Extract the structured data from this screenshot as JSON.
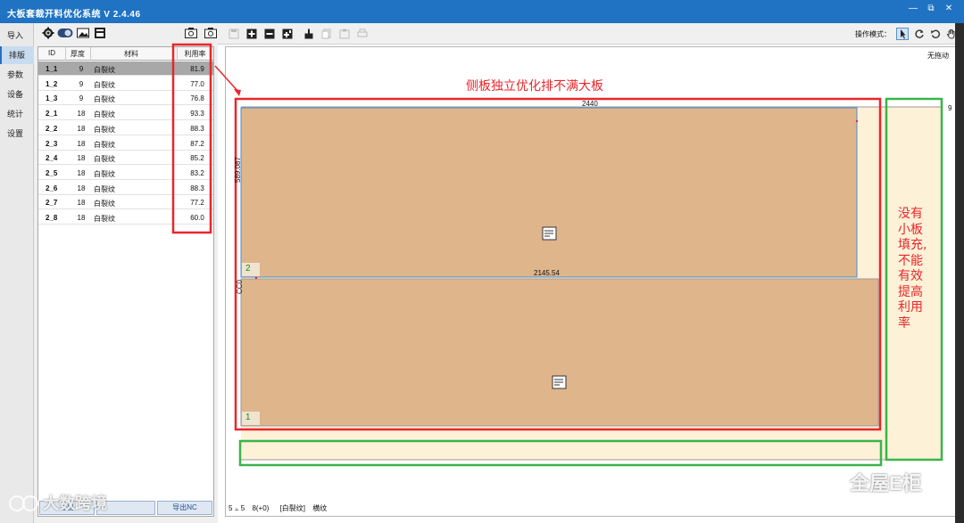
{
  "app": {
    "title": "大板套裁开料优化系统 V 2.4.46"
  },
  "window_controls": {
    "minimize": "—",
    "restore": "⧉",
    "close": "✕"
  },
  "nav": [
    "导入",
    "排版",
    "参数",
    "设备",
    "统计",
    "设置"
  ],
  "table": {
    "headers": [
      "ID",
      "厚度",
      "材料",
      "利用率"
    ],
    "rows": [
      {
        "id": "1_1",
        "thickness": "9",
        "material": "白裂纹",
        "rate": "81.9"
      },
      {
        "id": "1_2",
        "thickness": "9",
        "material": "白裂纹",
        "rate": "77.0"
      },
      {
        "id": "1_3",
        "thickness": "9",
        "material": "白裂纹",
        "rate": "76.8"
      },
      {
        "id": "2_1",
        "thickness": "18",
        "material": "白裂纹",
        "rate": "93.3"
      },
      {
        "id": "2_2",
        "thickness": "18",
        "material": "白裂纹",
        "rate": "88.3"
      },
      {
        "id": "2_3",
        "thickness": "18",
        "material": "白裂纹",
        "rate": "87.2"
      },
      {
        "id": "2_4",
        "thickness": "18",
        "material": "白裂纹",
        "rate": "85.2"
      },
      {
        "id": "2_5",
        "thickness": "18",
        "material": "白裂纹",
        "rate": "83.2"
      },
      {
        "id": "2_6",
        "thickness": "18",
        "material": "白裂纹",
        "rate": "88.3"
      },
      {
        "id": "2_7",
        "thickness": "18",
        "material": "白裂纹",
        "rate": "77.2"
      },
      {
        "id": "2_8",
        "thickness": "18",
        "material": "白裂纹",
        "rate": "60.0"
      }
    ]
  },
  "bottom_buttons": [
    "导出",
    "导出NC"
  ],
  "operation_mode_label": "操作模式：",
  "canvas": {
    "no_drag": "无拖动",
    "sheet_width": "2440",
    "piece2_height": "589.087",
    "piece2_number": "2",
    "piece1_width": "2145.54",
    "piece1_height": "CC0",
    "piece1_number": "1",
    "right_margin_label": "9"
  },
  "annotations": {
    "top": "侧板独立优化排不满大板",
    "right": [
      "没有",
      "小板",
      "填充,",
      "不能",
      "有效",
      "提高",
      "利用",
      "率"
    ]
  },
  "watermark": {
    "left": "大数跨境",
    "right": "全屋E柜"
  },
  "status": {
    "part1": "5 ⫠ 5",
    "part2": "8(+0)",
    "material": "[白裂纹]",
    "grain": "横纹"
  },
  "colors": {
    "titlebar": "#1f73c2",
    "board": "#dfb58c",
    "sheet_bg": "#fdf1d8",
    "red": "#e8262b",
    "green": "#39b54a"
  }
}
